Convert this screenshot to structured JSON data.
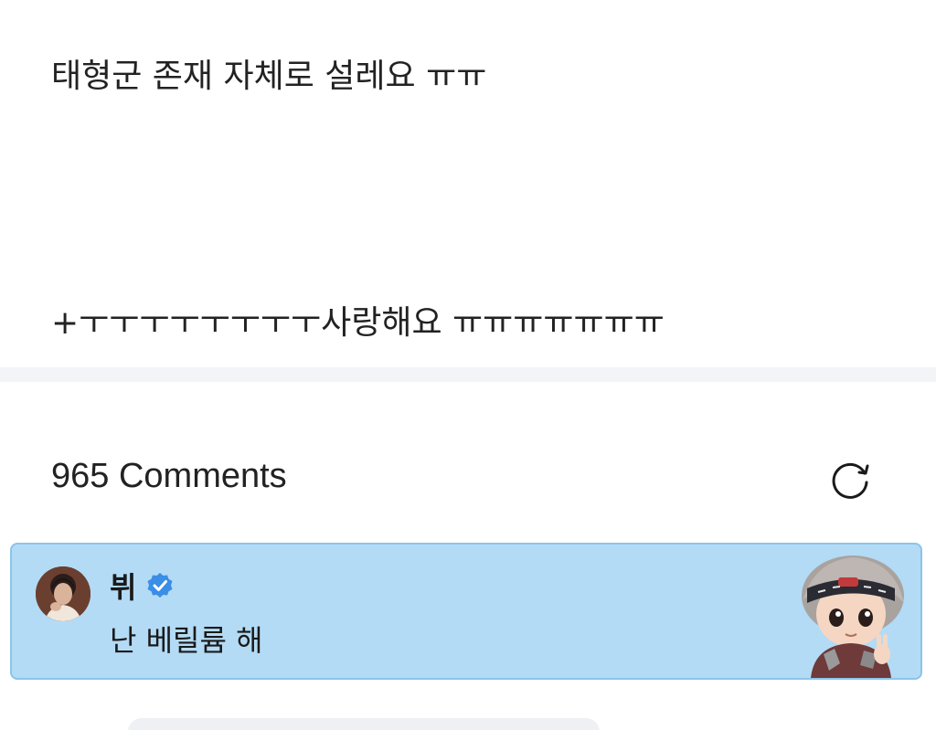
{
  "post": {
    "line1": "태형군 존재 자체로 설레요 ㅠㅠ",
    "line2": "+ㅜㅜㅜㅜㅜㅜㅜㅜ사랑해요 ㅠㅠㅠㅠㅠㅠㅠ"
  },
  "comments": {
    "header": "965 Comments",
    "refresh_icon": "refresh-icon"
  },
  "featured_comment": {
    "author": "뷔",
    "verified": true,
    "text": "난 베릴륨 해",
    "highlight_color": "#b3dbf5",
    "badge_color": "#3a8ee6"
  }
}
